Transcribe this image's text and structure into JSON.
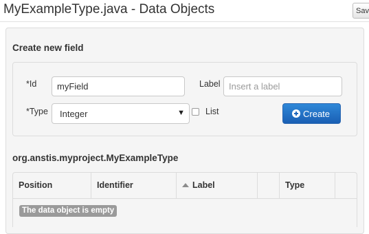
{
  "header": {
    "title": "MyExampleType.java - Data Objects",
    "save_label": "Save"
  },
  "create_field": {
    "section_title": "Create new field",
    "id_label": "*Id",
    "id_value": "myField",
    "label_label": "Label",
    "label_placeholder": "Insert a label",
    "type_label": "*Type",
    "type_selected": "Integer",
    "list_label": "List",
    "list_checked": false,
    "create_button": "Create"
  },
  "data_object": {
    "type_name": "org.anstis.myproject.MyExampleType",
    "columns": [
      "Position",
      "Identifier",
      "Label",
      "",
      "Type",
      ""
    ],
    "empty_message": "The data object is empty"
  },
  "colors": {
    "accent": "#1e67bd",
    "panel_bg": "#f5f5f5",
    "badge_bg": "#9a9a9a"
  },
  "icons": {
    "create": "plus-circle-icon",
    "sort": "sort-asc-icon",
    "dropdown": "caret-down-icon"
  }
}
